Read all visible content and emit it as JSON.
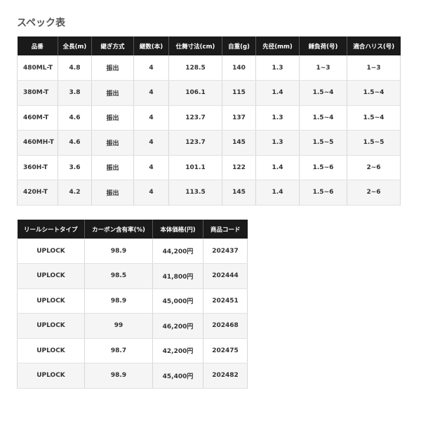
{
  "title": "スペック表",
  "spec_table": {
    "headers": [
      "品番",
      "全長(m)",
      "継ぎ方式",
      "継数(本)",
      "仕舞寸法(cm)",
      "自重(g)",
      "先径(mm)",
      "錘負荷(号)",
      "適合ハリス(号)"
    ],
    "rows": [
      [
        "480ML-T",
        "4.8",
        "振出",
        "4",
        "128.5",
        "140",
        "1.3",
        "1~3",
        "1~3"
      ],
      [
        "380M-T",
        "3.8",
        "振出",
        "4",
        "106.1",
        "115",
        "1.4",
        "1.5~4",
        "1.5~4"
      ],
      [
        "460M-T",
        "4.6",
        "振出",
        "4",
        "123.7",
        "137",
        "1.3",
        "1.5~4",
        "1.5~4"
      ],
      [
        "460MH-T",
        "4.6",
        "振出",
        "4",
        "123.7",
        "145",
        "1.3",
        "1.5~5",
        "1.5~5"
      ],
      [
        "360H-T",
        "3.6",
        "振出",
        "4",
        "101.1",
        "122",
        "1.4",
        "1.5~6",
        "2~6"
      ],
      [
        "420H-T",
        "4.2",
        "振出",
        "4",
        "113.5",
        "145",
        "1.4",
        "1.5~6",
        "2~6"
      ]
    ]
  },
  "price_table": {
    "headers": [
      "リールシートタイプ",
      "カーボン含有率(%)",
      "本体価格(円)",
      "商品コード"
    ],
    "rows": [
      [
        "UPLOCK",
        "98.9",
        "44,200円",
        "202437"
      ],
      [
        "UPLOCK",
        "98.5",
        "41,800円",
        "202444"
      ],
      [
        "UPLOCK",
        "98.9",
        "45,000円",
        "202451"
      ],
      [
        "UPLOCK",
        "99",
        "46,200円",
        "202468"
      ],
      [
        "UPLOCK",
        "98.7",
        "42,200円",
        "202475"
      ],
      [
        "UPLOCK",
        "98.9",
        "45,400円",
        "202482"
      ]
    ]
  }
}
